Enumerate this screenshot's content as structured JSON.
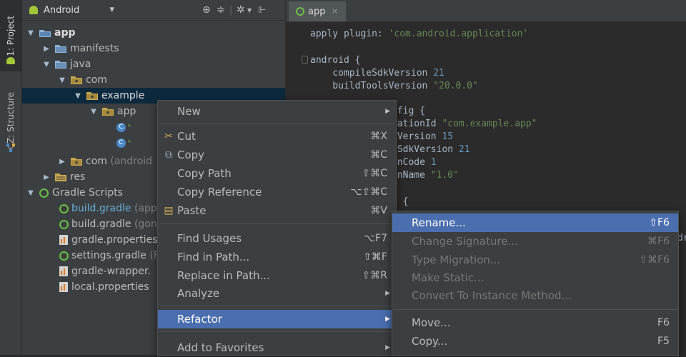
{
  "left_stripe": {
    "project_tab": "1: Project",
    "structure_tab": "Z: Structure"
  },
  "project_panel": {
    "view_selector": "Android",
    "tree": [
      {
        "label": "app",
        "extra": ""
      },
      {
        "label": "manifests",
        "extra": ""
      },
      {
        "label": "java",
        "extra": ""
      },
      {
        "label": "com",
        "extra": ""
      },
      {
        "label": "example",
        "extra": ""
      },
      {
        "label": "app",
        "extra": ""
      },
      {
        "label": "com",
        "extra": "(android"
      },
      {
        "label": "res",
        "extra": ""
      },
      {
        "label": "Gradle Scripts",
        "extra": ""
      },
      {
        "label": "build.gradle",
        "extra": "(app"
      },
      {
        "label": "build.gradle",
        "extra": "(gon"
      },
      {
        "label": "gradle.properties",
        "extra": ""
      },
      {
        "label": "settings.gradle",
        "extra": "(F"
      },
      {
        "label": "gradle-wrapper.",
        "extra": ""
      },
      {
        "label": "local.properties",
        "extra": ""
      }
    ]
  },
  "editor": {
    "tab_label": "app",
    "code": {
      "l1a": "apply plugin: ",
      "l1b": "'com.android.application'",
      "l2": "android {",
      "l3a": "    compileSdkVersion ",
      "l3b": "21",
      "l4a": "    buildToolsVersion ",
      "l4b": "\"20.0.0\"",
      "l5": "nfig {",
      "l6a": "cationId ",
      "l6b": "\"com.example.app\"",
      "l7a": "kVersion ",
      "l7b": "15",
      "l8a": "tSdkVersion ",
      "l8b": "21",
      "l9a": "onCode ",
      "l9b": "1",
      "l10a": "onName ",
      "l10b": "\"1.0\"",
      "l11": "s {",
      "l12": "dr"
    }
  },
  "context_menu": {
    "items": [
      {
        "label": "New",
        "shortcut": ""
      },
      {
        "label": "Cut",
        "shortcut": "⌘X"
      },
      {
        "label": "Copy",
        "shortcut": "⌘C"
      },
      {
        "label": "Copy Path",
        "shortcut": "⇧⌘C"
      },
      {
        "label": "Copy Reference",
        "shortcut": "⌥⇧⌘C"
      },
      {
        "label": "Paste",
        "shortcut": "⌘V"
      },
      {
        "label": "Find Usages",
        "shortcut": "⌥F7"
      },
      {
        "label": "Find in Path...",
        "shortcut": "⇧⌘F"
      },
      {
        "label": "Replace in Path...",
        "shortcut": "⇧⌘R"
      },
      {
        "label": "Analyze",
        "shortcut": ""
      },
      {
        "label": "Refactor",
        "shortcut": ""
      },
      {
        "label": "Add to Favorites",
        "shortcut": ""
      }
    ]
  },
  "refactor_menu": {
    "items": [
      {
        "label": "Rename...",
        "shortcut": "⇧F6"
      },
      {
        "label": "Change Signature...",
        "shortcut": "⌘F6"
      },
      {
        "label": "Type Migration...",
        "shortcut": "⇧⌘F6"
      },
      {
        "label": "Make Static...",
        "shortcut": ""
      },
      {
        "label": "Convert To Instance Method...",
        "shortcut": ""
      },
      {
        "label": "Move...",
        "shortcut": "F6"
      },
      {
        "label": "Copy...",
        "shortcut": "F5"
      }
    ]
  },
  "colors": {
    "selection": "#4b6eaf",
    "panel": "#3c3f41",
    "editor_bg": "#2b2b2b",
    "tree_selected": "#0d293e"
  }
}
